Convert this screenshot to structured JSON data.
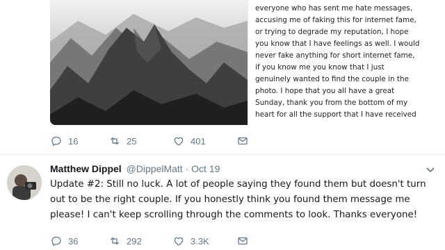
{
  "tweet1": {
    "note_lines": [
      "everyone who has sent me hate messages,",
      "accusing me of faking this for internet fame,",
      "or trying to degrade my reputation, I hope",
      "you know that I have feelings as well. I would",
      "never fake anything for short internet fame,",
      "if you know me you know that I just",
      "genuinely wanted to find the couple in the",
      "photo. I hope that you all have a great",
      "Sunday, thank you from the bottom of my",
      "heart for all the support that I have received"
    ],
    "replies": "16",
    "retweets": "25",
    "likes": "401"
  },
  "tweet2": {
    "display_name": "Matthew Dippel",
    "handle": "@DippelMatt",
    "separator": " · ",
    "time": "Oct 19",
    "body_lines": [
      "Update #2: Still no luck. A lot of people saying they found them but doesn't turn",
      "out to be the right couple. If you honestly think you found them message me",
      "please! I can't keep scrolling through the comments to look. Thanks everyone!"
    ],
    "replies": "36",
    "retweets": "292",
    "likes": "3.3K"
  },
  "icons": {
    "reply": "reply-icon",
    "retweet": "retweet-icon",
    "like": "heart-icon",
    "dm": "envelope-icon",
    "more": "chevron-down-icon"
  },
  "colors": {
    "icon_gray": "#657786",
    "text": "#14171a",
    "border": "#e6ecf0"
  }
}
